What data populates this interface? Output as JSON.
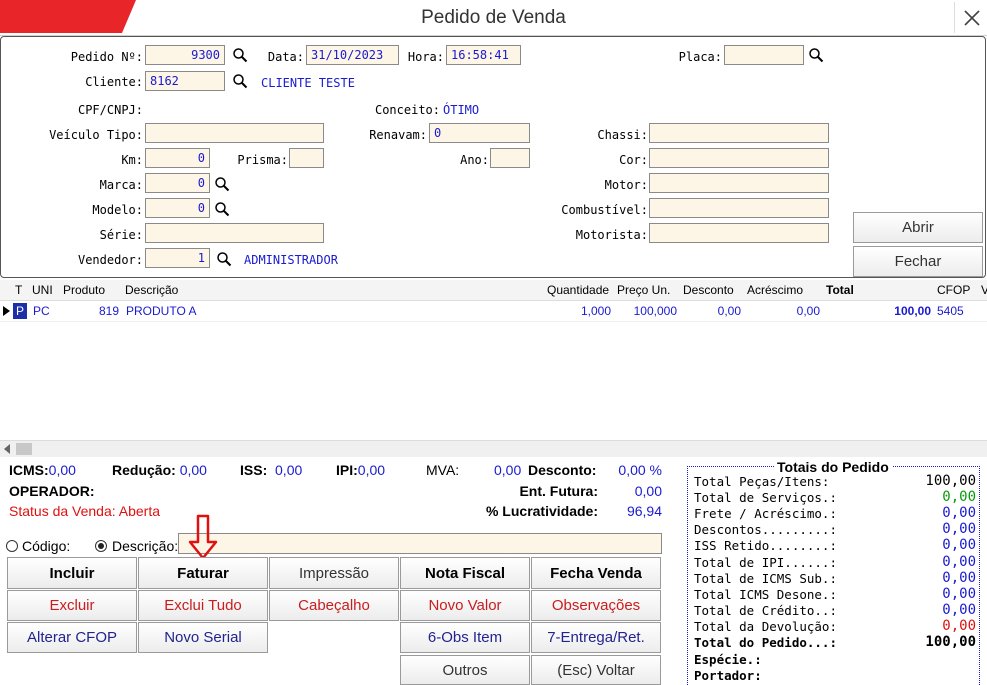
{
  "window": {
    "title": "Pedido de Venda"
  },
  "header": {
    "pedido": {
      "label": "Pedido Nº:",
      "value": "9300"
    },
    "data": {
      "label": "Data:",
      "value": "31/10/2023"
    },
    "hora": {
      "label": "Hora:",
      "value": "16:58:41"
    },
    "placa": {
      "label": "Placa:",
      "value": ""
    },
    "cliente": {
      "label": "Cliente:",
      "value": "8162",
      "name": "CLIENTE TESTE"
    },
    "cpf": {
      "label": "CPF/CNPJ:"
    },
    "conceito": {
      "label": "Conceito:",
      "value": "ÓTIMO"
    },
    "veiculo_tipo": {
      "label": "Veículo Tipo:",
      "value": ""
    },
    "renavam": {
      "label": "Renavam:",
      "value": "0"
    },
    "chassi": {
      "label": "Chassi:",
      "value": ""
    },
    "km": {
      "label": "Km:",
      "value": "0"
    },
    "prisma": {
      "label": "Prisma:",
      "value": ""
    },
    "ano": {
      "label": "Ano:",
      "value": ""
    },
    "cor": {
      "label": "Cor:",
      "value": ""
    },
    "marca": {
      "label": "Marca:",
      "value": "0"
    },
    "motor": {
      "label": "Motor:",
      "value": ""
    },
    "modelo": {
      "label": "Modelo:",
      "value": "0"
    },
    "combustivel": {
      "label": "Combustível:",
      "value": ""
    },
    "serie": {
      "label": "Série:",
      "value": ""
    },
    "motorista": {
      "label": "Motorista:",
      "value": ""
    },
    "vendedor": {
      "label": "Vendedor:",
      "value": "1",
      "name": "ADMINISTRADOR"
    },
    "abrir": "Abrir",
    "fechar": "Fechar"
  },
  "grid": {
    "columns": [
      "T",
      "UNI",
      "Produto",
      "Descrição",
      "Quantidade",
      "Preço Un.",
      "Desconto",
      "Acréscimo",
      "Total",
      "CFOP",
      "V"
    ],
    "rows": [
      {
        "t": "P",
        "uni": "PC",
        "produto": "819",
        "descricao": "PRODUTO A",
        "quantidade": "1,000",
        "preco": "100,000",
        "desconto": "0,00",
        "acrescimo": "0,00",
        "total": "100,00",
        "cfop": "5405"
      }
    ]
  },
  "summary": {
    "icms_label": "ICMS:",
    "icms": "0,00",
    "reducao_label": "Redução:",
    "reducao": "0,00",
    "iss_label": "ISS:",
    "iss": "0,00",
    "ipi_label": "IPI:",
    "ipi": "0,00",
    "mva_label": "MVA:",
    "mva": "0,00",
    "desconto_label": "Desconto:",
    "desconto": "0,00 %",
    "operador_label": "OPERADOR:",
    "ent_futura_label": "Ent. Futura:",
    "ent_futura": "0,00",
    "status": "Status da Venda: Aberta",
    "lucratividade_label": "% Lucratividade:",
    "lucratividade": "96,94"
  },
  "search": {
    "codigo_label": "Código:",
    "descricao_label": "Descrição:",
    "value": ""
  },
  "buttons": {
    "incluir": "Incluir",
    "faturar": "Faturar",
    "impressao": "Impressão",
    "nota_fiscal": "Nota Fiscal",
    "fecha_venda": "Fecha Venda",
    "excluir": "Excluir",
    "exclui_tudo": "Exclui Tudo",
    "cabecalho": "Cabeçalho",
    "novo_valor": "Novo Valor",
    "observacoes": "Observações",
    "alterar_cfop": "Alterar CFOP",
    "novo_serial": "Novo Serial",
    "obs_item": "6-Obs Item",
    "entrega_ret": "7-Entrega/Ret.",
    "outros": "Outros",
    "voltar": "(Esc) Voltar"
  },
  "totais": {
    "title": "Totais do Pedido",
    "rows": [
      {
        "label": "Total Peças/Itens:",
        "value": "100,00",
        "color": "#000000"
      },
      {
        "label": "Total de Serviços.:",
        "value": "0,00",
        "color": "#0a9a0a"
      },
      {
        "label": "Frete / Acréscimo.:",
        "value": "0,00",
        "color": "#1a1ad0"
      },
      {
        "label": "Descontos.........:",
        "value": "0,00",
        "color": "#1a1ad0"
      },
      {
        "label": "ISS Retido........:",
        "value": "0,00",
        "color": "#1a1ad0"
      },
      {
        "label": "Total de IPI......:",
        "value": "0,00",
        "color": "#1a1ad0"
      },
      {
        "label": "Total de ICMS Sub.:",
        "value": "0,00",
        "color": "#1a1ad0"
      },
      {
        "label": "Total ICMS Desone.:",
        "value": "0,00",
        "color": "#1a1ad0"
      },
      {
        "label": "Total de Crédito..:",
        "value": "0,00",
        "color": "#1a1ad0"
      },
      {
        "label": "Total da Devolução:",
        "value": "0,00",
        "color": "#e01010"
      },
      {
        "label": "Total do Pedido...:",
        "value": "100,00",
        "color": "#000000"
      }
    ],
    "especie_label": "Espécie.:",
    "portador_label": "Portador:"
  }
}
